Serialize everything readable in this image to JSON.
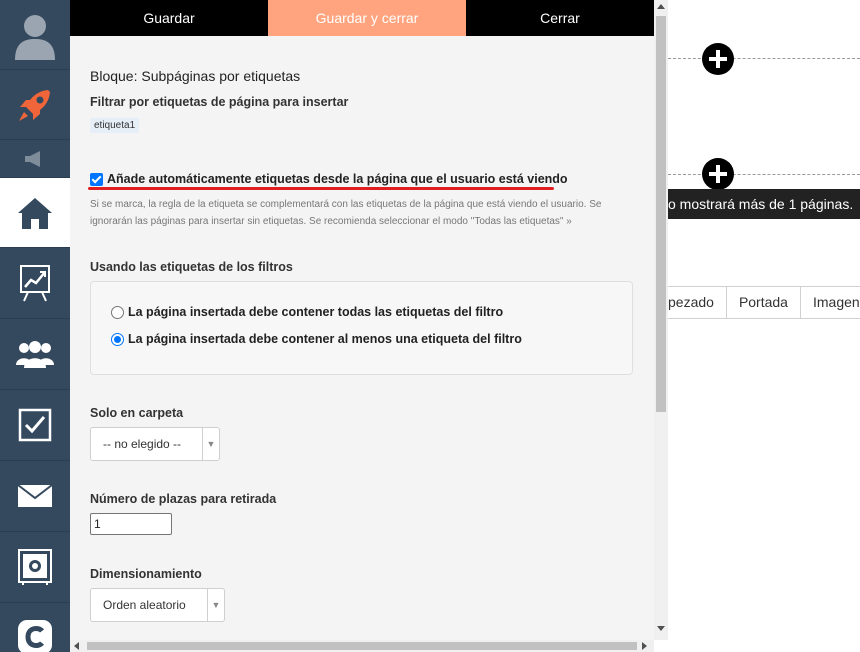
{
  "sidebar": {
    "items": [
      {
        "icon": "user-avatar-icon"
      },
      {
        "icon": "rocket-icon"
      },
      {
        "icon": "megaphone-icon"
      },
      {
        "icon": "home-icon",
        "active": true
      },
      {
        "icon": "chart-board-icon"
      },
      {
        "icon": "users-group-icon"
      },
      {
        "icon": "checkbox-icon"
      },
      {
        "icon": "envelope-icon"
      },
      {
        "icon": "safe-icon"
      },
      {
        "icon": "c-logo-icon"
      }
    ]
  },
  "toolbar": {
    "save_label": "Guardar",
    "save_close_label": "Guardar y cerrar",
    "close_label": "Cerrar"
  },
  "form": {
    "block_title": "Bloque: Subpáginas por etiquetas",
    "filter_label": "Filtrar por etiquetas de página para insertar",
    "filter_tag": "etiqueta1",
    "auto_tags_label": "Añade automáticamente etiquetas desde la página que el usuario está viendo",
    "auto_tags_checked": true,
    "auto_tags_help": "Si se marca, la regla de la etiqueta se complementará con las etiquetas de la página que está viendo el usuario. Se ignorarán las páginas para insertar sin etiquetas. Se recomienda seleccionar el modo \"Todas las etiquetas\" »",
    "using_label": "Usando las etiquetas de los filtros",
    "radio_all_label": "La página insertada debe contener todas las etiquetas del filtro",
    "radio_any_label": "La página insertada debe contener al menos una etiqueta del filtro",
    "radio_selected": "any",
    "folder_label": "Solo en carpeta",
    "folder_value": "-- no elegido --",
    "seats_label": "Número de plazas para retirada",
    "seats_value": "1",
    "dim_label": "Dimensionamiento",
    "dim_value": "Orden aleatorio"
  },
  "background": {
    "notice_text": "o mostrará más de 1 páginas.",
    "tabs": [
      "pezado",
      "Portada",
      "Imagen"
    ]
  },
  "colors": {
    "sidebar_bg": "#34495e",
    "accent_orange": "#ffa47e",
    "rocket_orange": "#f0653a",
    "checkbox_blue": "#0075ff",
    "underline_red": "#e02020"
  }
}
